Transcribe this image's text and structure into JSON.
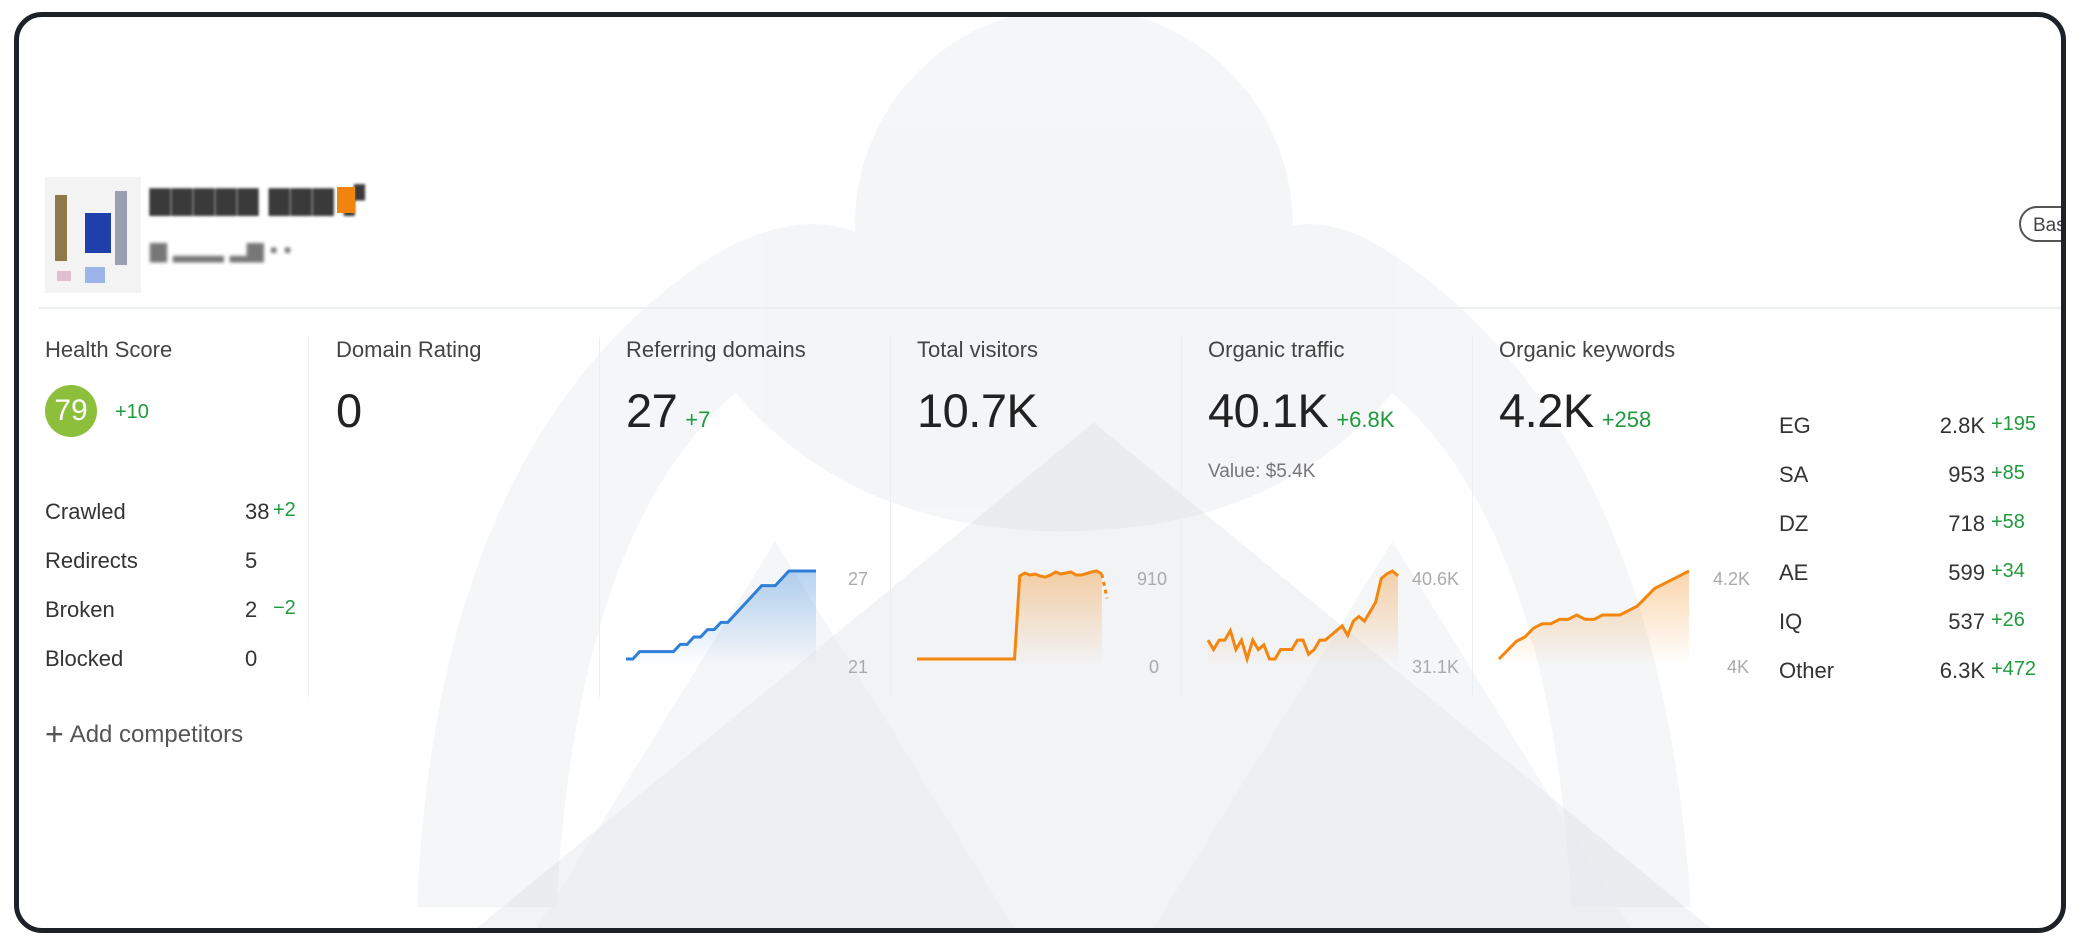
{
  "header": {
    "project_name": "▇▇▇▇▇ ▇▇▇ ▞",
    "project_url": "▆  ▂▂▂  ▂▆    ▪  ▪"
  },
  "plan_badge": "Basi",
  "colors": {
    "health_badge": "#8bbf3c",
    "positive_delta": "#1f9a3c",
    "referring_line": "#2f7fd8",
    "traffic_line": "#f2860f"
  },
  "health": {
    "title": "Health Score",
    "score": "79",
    "delta": "+10",
    "rows": [
      {
        "label": "Crawled",
        "value": "38",
        "delta": "+2"
      },
      {
        "label": "Redirects",
        "value": "5",
        "delta": ""
      },
      {
        "label": "Broken",
        "value": "2",
        "delta": "−2"
      },
      {
        "label": "Blocked",
        "value": "0",
        "delta": ""
      }
    ]
  },
  "domain_rating": {
    "title": "Domain Rating",
    "value": "0"
  },
  "referring_domains": {
    "title": "Referring domains",
    "value": "27",
    "delta": "+7",
    "axis_max": "27",
    "axis_min": "21",
    "series": [
      21,
      21,
      21.5,
      21.5,
      21.5,
      21.5,
      21.5,
      21.5,
      22,
      22,
      22.5,
      22.5,
      23,
      23,
      23.5,
      23.5,
      24,
      24.5,
      25,
      25.5,
      26,
      26,
      26,
      26.5,
      27,
      27,
      27,
      27,
      27
    ]
  },
  "total_visitors": {
    "title": "Total visitors",
    "value": "10.7K",
    "axis_max": "910",
    "axis_min": "0",
    "series": [
      0,
      0,
      0,
      0,
      0,
      0,
      0,
      0,
      0,
      0,
      0,
      0,
      0,
      0,
      0,
      0,
      0,
      0,
      0,
      0,
      820,
      850,
      830,
      840,
      820,
      810,
      830,
      860,
      840,
      850,
      860,
      830,
      830,
      845,
      860,
      870,
      840,
      600
    ]
  },
  "organic_traffic": {
    "title": "Organic traffic",
    "value": "40.1K",
    "delta": "+6.8K",
    "value_note": "Value: $5.4K",
    "axis_max": "40.6K",
    "axis_min": "31.1K",
    "series": [
      33,
      32,
      33,
      33,
      34,
      32,
      33,
      31,
      33,
      32,
      32.5,
      31,
      31,
      32,
      32,
      32,
      33,
      33,
      31.5,
      32,
      33,
      33,
      33.5,
      34,
      34.5,
      33.5,
      35,
      35.5,
      35,
      36,
      37,
      39.5,
      40,
      40.3,
      39.8
    ]
  },
  "organic_keywords": {
    "title": "Organic keywords",
    "value": "4.2K",
    "delta": "+258",
    "axis_max": "4.2K",
    "axis_min": "4K",
    "series": [
      4.0,
      4.02,
      4.04,
      4.05,
      4.07,
      4.08,
      4.08,
      4.09,
      4.09,
      4.1,
      4.09,
      4.09,
      4.1,
      4.1,
      4.1,
      4.11,
      4.12,
      4.14,
      4.16,
      4.17,
      4.18,
      4.19,
      4.2
    ]
  },
  "countries": [
    {
      "code": "EG",
      "value": "2.8K",
      "delta": "+195"
    },
    {
      "code": "SA",
      "value": "953",
      "delta": "+85"
    },
    {
      "code": "DZ",
      "value": "718",
      "delta": "+58"
    },
    {
      "code": "AE",
      "value": "599",
      "delta": "+34"
    },
    {
      "code": "IQ",
      "value": "537",
      "delta": "+26"
    },
    {
      "code": "Other",
      "value": "6.3K",
      "delta": "+472"
    }
  ],
  "add_competitors": "Add competitors"
}
